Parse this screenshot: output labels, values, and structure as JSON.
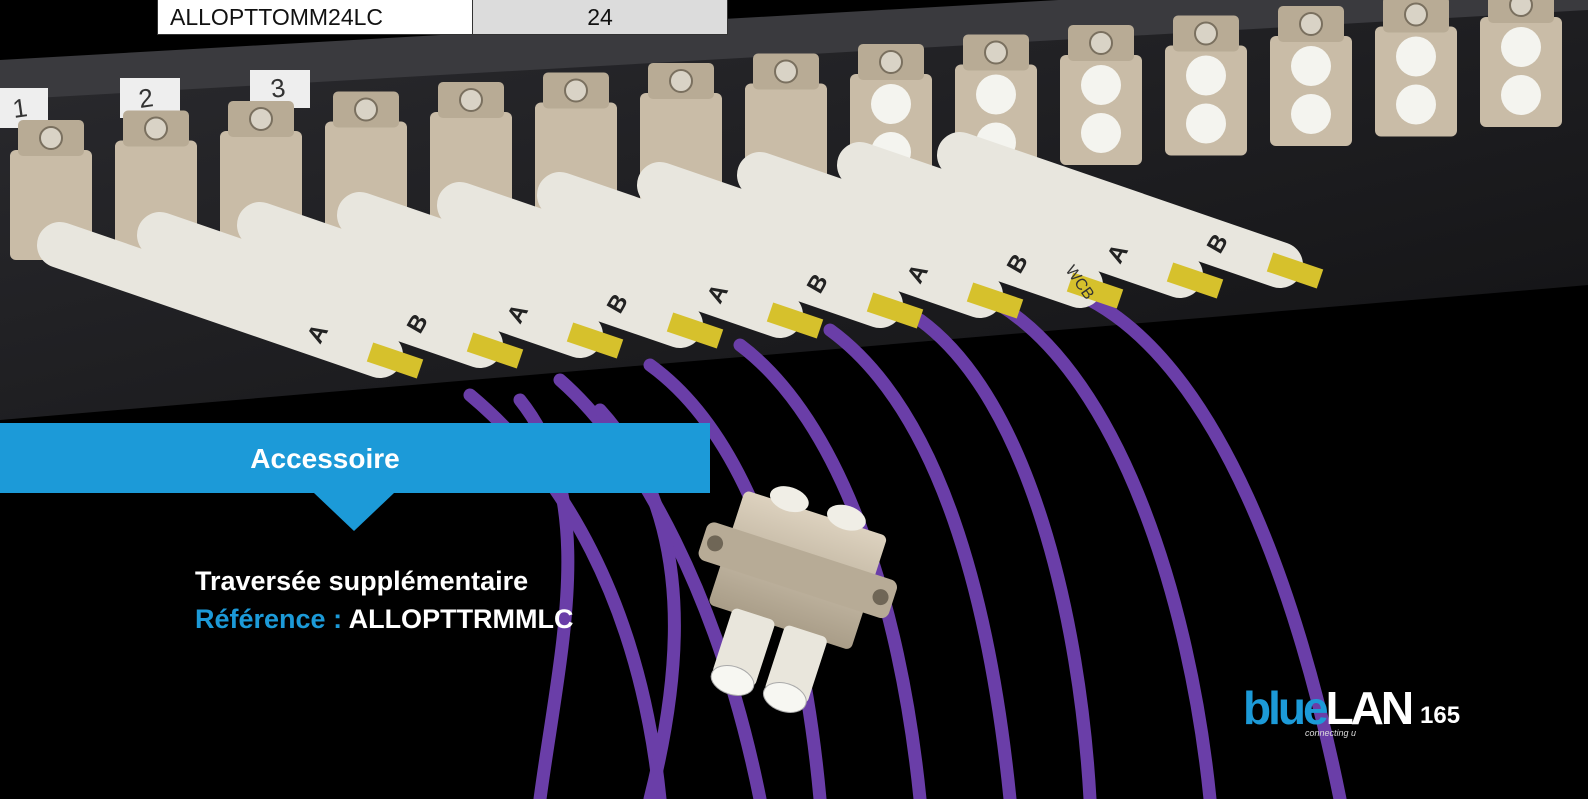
{
  "table": {
    "reference": "ALLOPTTOMM24LC",
    "quantity": "24"
  },
  "panel": {
    "port_numbers": [
      "1",
      "2",
      "3"
    ],
    "connector_labels": [
      "A",
      "B"
    ],
    "cable_marking": "WCB",
    "colors": {
      "panel": "#1f1f22",
      "adapter": "#c8bba6",
      "boot": "#e8e6de",
      "ferrule_band": "#d6c12c",
      "cable": "#6a3ea8"
    }
  },
  "banner": {
    "title": "Accessoire",
    "color": "#1c9ad8"
  },
  "accessory": {
    "name": "Traversée supplémentaire",
    "reference_label": "Référence :",
    "reference_value": "ALLOPTTRMMLC"
  },
  "logo": {
    "part1": "blue",
    "part2": "LAN",
    "tagline": "connecting u"
  },
  "page_number": "165"
}
